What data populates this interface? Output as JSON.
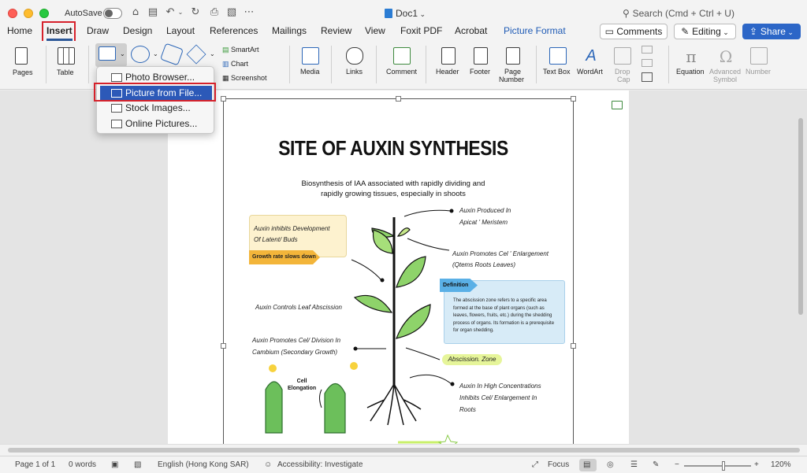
{
  "window": {
    "autosave_label": "AutoSave",
    "doc_title": "Doc1",
    "search_placeholder": "Search (Cmd + Ctrl + U)"
  },
  "tabs": [
    "Home",
    "Insert",
    "Draw",
    "Design",
    "Layout",
    "References",
    "Mailings",
    "Review",
    "View",
    "Foxit PDF",
    "Acrobat",
    "Picture Format"
  ],
  "active_tab": "Insert",
  "header_buttons": {
    "comments": "Comments",
    "editing": "Editing",
    "share": "Share"
  },
  "ribbon": {
    "pages": "Pages",
    "table": "Table",
    "smartart": "SmartArt",
    "chart": "Chart",
    "screenshot": "Screenshot",
    "media": "Media",
    "links": "Links",
    "comment": "Comment",
    "header": "Header",
    "footer": "Footer",
    "page_number_1": "Page",
    "page_number_2": "Number",
    "text_box": "Text Box",
    "wordart": "WordArt",
    "drop_cap_1": "Drop",
    "drop_cap_2": "Cap",
    "equation": "Equation",
    "advanced_symbol_1": "Advanced",
    "advanced_symbol_2": "Symbol",
    "number": "Number"
  },
  "picture_menu": {
    "items": [
      "Photo Browser...",
      "Picture from File...",
      "Stock Images...",
      "Online Pictures..."
    ],
    "selected": "Picture from File..."
  },
  "infographic": {
    "title": "SITE OF AUXIN SYNTHESIS",
    "subtitle_1": "Biosynthesis of IAA associated with rapidly dividing and",
    "subtitle_2": "rapidly growing tissues, especially in shoots",
    "inhibits_1": "Auxin inhibits Development",
    "inhibits_2": "Of Latent/ Buds",
    "growth_tag": "Growth rate slows down",
    "produced_1": "Auxin Produced In",
    "produced_2": "Apicat ' Meristem",
    "promotes_1": "Auxin Promotes Cel ' Enlargement",
    "promotes_2": "(Qtems Roots Leaves)",
    "definition_tag": "Definition",
    "definition_text": "The abscission zone refers to a specific area formed at the base of plant organs (such as leaves, flowers, fruits, etc.) during the shedding process of organs. Its formation is a prerequisite for organ shedding.",
    "leaf_abscission": "Auxin Controls Leaf Abscission",
    "division_1": "Auxin Promotes Cel/ Division In",
    "division_2": "Cambium (Secondary Growth)",
    "abscission_zone": "Abscission. Zone",
    "high_conc_1": "Auxin In High Concentrations",
    "high_conc_2": "Inhibits Cel/ Enlargement In",
    "high_conc_3": "Roots",
    "cell_label_1": "Cell",
    "cell_label_2": "Elongation"
  },
  "status_bar": {
    "page": "Page 1 of 1",
    "words": "0 words",
    "language": "English (Hong Kong SAR)",
    "accessibility": "Accessibility: Investigate",
    "focus": "Focus",
    "zoom": "120%"
  },
  "colors": {
    "accent_blue": "#2c59b8",
    "highlight_red": "#d6212b",
    "leaf_green": "#8ed36a",
    "callout_yellow": "#fdf2cf",
    "definition_blue": "#d7ebf7"
  }
}
